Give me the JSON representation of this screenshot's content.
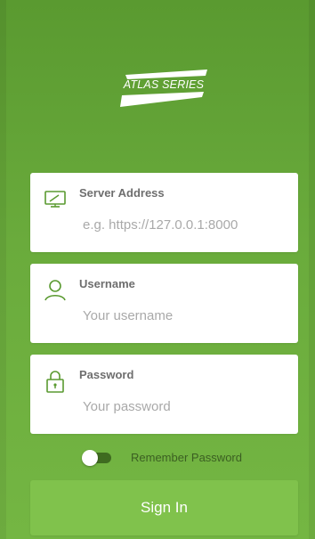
{
  "logo": {
    "text": "ATLAS SERIES"
  },
  "form": {
    "server": {
      "label": "Server Address",
      "placeholder": "e.g. https://127.0.0.1:8000",
      "value": "",
      "icon": "monitor-icon"
    },
    "username": {
      "label": "Username",
      "placeholder": "Your username",
      "value": "",
      "icon": "user-icon"
    },
    "password": {
      "label": "Password",
      "placeholder": "Your password",
      "value": "",
      "icon": "lock-icon"
    },
    "remember": {
      "label": "Remember Password",
      "checked": false
    },
    "signin_label": "Sign In"
  },
  "colors": {
    "background_top": "#5a9a30",
    "background_bottom": "#74b643",
    "accent_green": "#6aab3c",
    "button_green": "#80c24c",
    "card_white": "#ffffff",
    "label_gray": "#6e6e6e",
    "placeholder_gray": "#a9a9a9"
  }
}
